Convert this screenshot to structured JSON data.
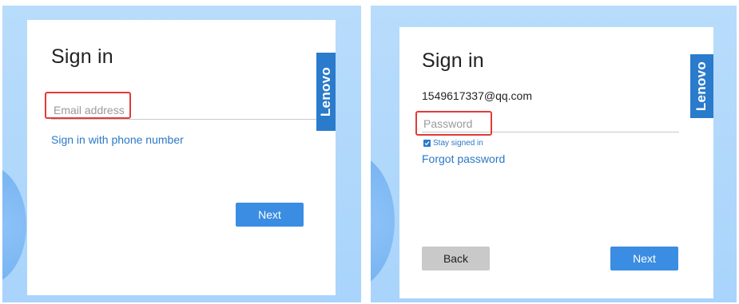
{
  "email_step": {
    "title": "Sign in",
    "email_placeholder": "Email address",
    "phone_link": "Sign in with phone number",
    "next_label": "Next",
    "brand": "Lenovo"
  },
  "password_step": {
    "title": "Sign in",
    "email_value": "1549617337@qq.com",
    "password_placeholder": "Password",
    "stay_signed_in_label": "Stay signed in",
    "stay_signed_in_checked": true,
    "forgot_link": "Forgot password",
    "back_label": "Back",
    "next_label": "Next",
    "brand": "Lenovo"
  },
  "colors": {
    "background": "#b8dcfb",
    "brand_blue": "#2a7bcb",
    "button_blue": "#3a8de2",
    "highlight_red": "#e23a3a",
    "link_blue": "#2b78c6"
  }
}
